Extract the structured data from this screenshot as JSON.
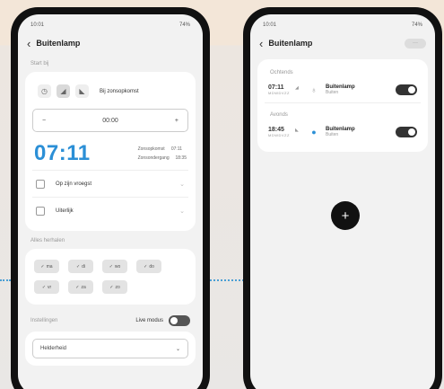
{
  "left": {
    "status": {
      "time": "10:01",
      "right": "74%"
    },
    "title": "Buitenlamp",
    "section_start": "Start bij",
    "mode_label": "Bij zonsopkomst",
    "stepper": {
      "minus": "−",
      "value": "00:00",
      "plus": "+"
    },
    "big_time": "07:11",
    "sun": {
      "rise_label": "Zonsopkomst",
      "rise_value": "07:11",
      "set_label": "Zonsondergang",
      "set_value": "18:35"
    },
    "options": [
      {
        "label": "Op zijn vroegst"
      },
      {
        "label": "Uiterlijk"
      }
    ],
    "section_days": "Alles herhalen",
    "days": [
      "ma",
      "di",
      "wo",
      "do",
      "vr",
      "za",
      "zo"
    ],
    "section_settings": "Instellingen",
    "live_mode_label": "Live modus",
    "dropdown_value": "Helderheid"
  },
  "right": {
    "status": {
      "time": "10:01",
      "right": "74%"
    },
    "title": "Buitenlamp",
    "pill": "···",
    "groups": [
      {
        "label": "Ochtends",
        "time": "07:11",
        "days": "MDWDVZZ",
        "name": "Buitenlamp",
        "room": "Buiten"
      },
      {
        "label": "Avonds",
        "time": "18:45",
        "days": "MDWDVZZ",
        "name": "Buitenlamp",
        "room": "Buiten"
      }
    ],
    "fab": "+"
  },
  "colors": {
    "accent": "#2b8fd6",
    "toggle_on": "#333333"
  }
}
